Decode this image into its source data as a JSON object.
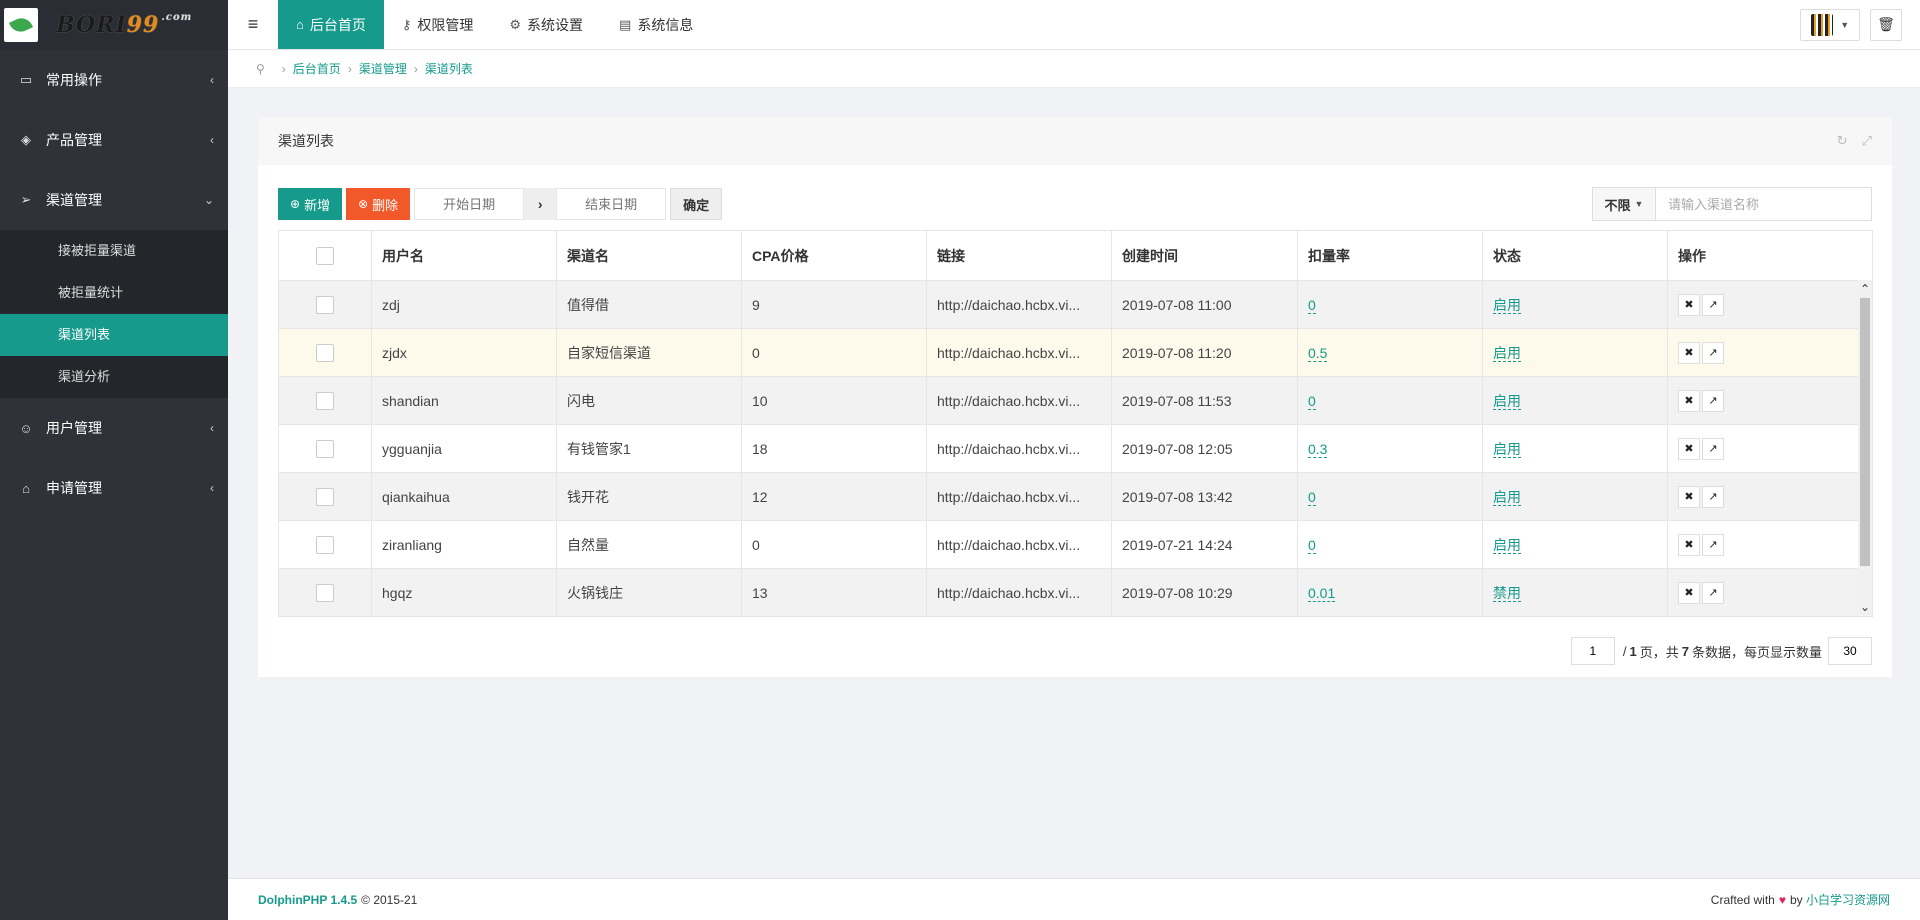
{
  "logo": {
    "text_main": "BORI",
    "text_num": "99",
    "text_com": ".com"
  },
  "sidebar": {
    "items": [
      {
        "label": "常用操作",
        "icon": "folder-icon",
        "arrow": "‹"
      },
      {
        "label": "产品管理",
        "icon": "layers-icon",
        "arrow": "‹"
      },
      {
        "label": "渠道管理",
        "icon": "send-icon",
        "arrow": "⌄",
        "children": [
          {
            "label": "接被拒量渠道"
          },
          {
            "label": "被拒量统计"
          },
          {
            "label": "渠道列表"
          },
          {
            "label": "渠道分析"
          }
        ]
      },
      {
        "label": "用户管理",
        "icon": "user-icon",
        "arrow": "‹"
      },
      {
        "label": "申请管理",
        "icon": "tag-icon",
        "arrow": "‹"
      }
    ]
  },
  "topbar": {
    "tabs": [
      {
        "label": "后台首页",
        "icon": "home-icon"
      },
      {
        "label": "权限管理",
        "icon": "key-icon"
      },
      {
        "label": "系统设置",
        "icon": "gear-icon"
      },
      {
        "label": "系统信息",
        "icon": "file-icon"
      }
    ]
  },
  "breadcrumb": [
    "后台首页",
    "渠道管理",
    "渠道列表"
  ],
  "panel": {
    "title": "渠道列表",
    "toolbar": {
      "add_label": "新增",
      "delete_label": "删除",
      "start_date_placeholder": "开始日期",
      "end_date_placeholder": "结束日期",
      "confirm_label": "确定",
      "filter_label": "不限",
      "search_placeholder": "请输入渠道名称"
    },
    "table": {
      "columns": [
        "用户名",
        "渠道名",
        "CPA价格",
        "链接",
        "创建时间",
        "扣量率",
        "状态",
        "操作"
      ],
      "rows": [
        {
          "username": "zdj",
          "channel": "值得借",
          "cpa": "9",
          "link": "http://daichao.hcbx.vi...",
          "created": "2019-07-08 11:00",
          "rate": "0",
          "status": "启用"
        },
        {
          "username": "zjdx",
          "channel": "自家短信渠道",
          "cpa": "0",
          "link": "http://daichao.hcbx.vi...",
          "created": "2019-07-08 11:20",
          "rate": "0.5",
          "status": "启用"
        },
        {
          "username": "shandian",
          "channel": "闪电",
          "cpa": "10",
          "link": "http://daichao.hcbx.vi...",
          "created": "2019-07-08 11:53",
          "rate": "0",
          "status": "启用"
        },
        {
          "username": "ygguanjia",
          "channel": "有钱管家1",
          "cpa": "18",
          "link": "http://daichao.hcbx.vi...",
          "created": "2019-07-08 12:05",
          "rate": "0.3",
          "status": "启用"
        },
        {
          "username": "qiankaihua",
          "channel": "钱开花",
          "cpa": "12",
          "link": "http://daichao.hcbx.vi...",
          "created": "2019-07-08 13:42",
          "rate": "0",
          "status": "启用"
        },
        {
          "username": "ziranliang",
          "channel": "自然量",
          "cpa": "0",
          "link": "http://daichao.hcbx.vi...",
          "created": "2019-07-21 14:24",
          "rate": "0",
          "status": "启用"
        },
        {
          "username": "hgqz",
          "channel": "火锅钱庄",
          "cpa": "13",
          "link": "http://daichao.hcbx.vi...",
          "created": "2019-07-08 10:29",
          "rate": "0.01",
          "status": "禁用"
        }
      ]
    },
    "pagination": {
      "current": "1",
      "total_pages": "1",
      "total_items": "7",
      "page_size": "30",
      "text_pages": "页，共",
      "text_items": "条数据，每页显示数量"
    }
  },
  "footer": {
    "brand": "DolphinPHP 1.4.5",
    "copyright": "© 2015-21",
    "crafted": "Crafted with",
    "by": "by",
    "site": "小白学习资源网"
  },
  "colors": {
    "accent": "#159a8c",
    "danger": "#f1592a",
    "sidebar": "#2f3238"
  }
}
